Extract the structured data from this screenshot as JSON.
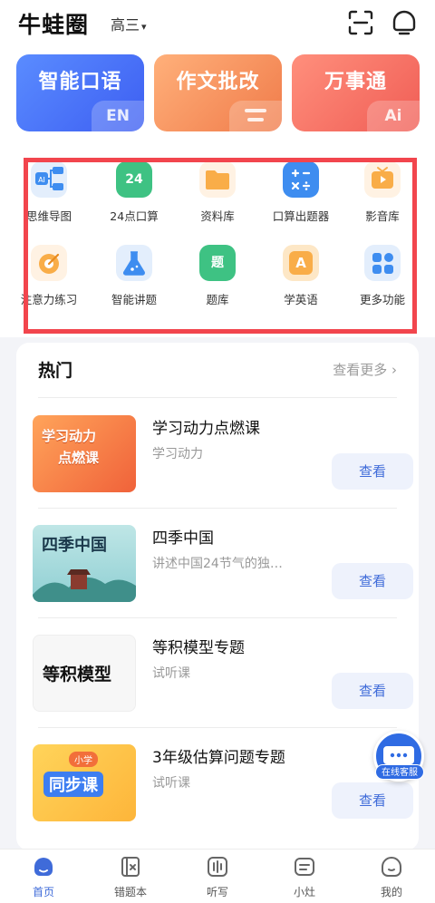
{
  "header": {
    "app_title": "牛蛙圈",
    "grade": "高三",
    "grade_caret": "▾"
  },
  "feature_cards": [
    {
      "label": "智能口语",
      "badge": "EN"
    },
    {
      "label": "作文批改",
      "badge": ""
    },
    {
      "label": "万事通",
      "badge": "Ai"
    }
  ],
  "tools": [
    {
      "label": "思维导图",
      "icon": "mind-map-icon",
      "icon_text": "AI"
    },
    {
      "label": "24点口算",
      "icon": "twenty-four-icon",
      "icon_text": "24"
    },
    {
      "label": "资料库",
      "icon": "folder-icon",
      "icon_text": ""
    },
    {
      "label": "口算出题器",
      "icon": "calculator-icon",
      "icon_text": ""
    },
    {
      "label": "影音库",
      "icon": "media-icon",
      "icon_text": ""
    },
    {
      "label": "注意力练习",
      "icon": "target-icon",
      "icon_text": ""
    },
    {
      "label": "智能讲题",
      "icon": "flask-icon",
      "icon_text": ""
    },
    {
      "label": "题库",
      "icon": "question-bank-icon",
      "icon_text": "题"
    },
    {
      "label": "学英语",
      "icon": "english-icon",
      "icon_text": "A"
    },
    {
      "label": "更多功能",
      "icon": "more-functions-icon",
      "icon_text": ""
    }
  ],
  "hot": {
    "title": "热门",
    "see_more": "查看更多 ›",
    "courses": [
      {
        "title": "学习动力点燃课",
        "subtitle": "学习动力",
        "button": "查看",
        "thumb_text_1": "学习动力",
        "thumb_text_2": "点燃课"
      },
      {
        "title": "四季中国",
        "subtitle": "讲述中国24节气的独…",
        "button": "查看",
        "thumb_text_1": "四季中国"
      },
      {
        "title": "等积模型专题",
        "subtitle": "试听课",
        "button": "查看",
        "thumb_text_1": "等积模型"
      },
      {
        "title": "3年级估算问题专题",
        "subtitle": "试听课",
        "button": "查看",
        "thumb_tag": "小学",
        "thumb_text_1": "同步课"
      }
    ]
  },
  "service": {
    "label": "在线客服"
  },
  "bottom_nav": [
    {
      "label": "首页",
      "icon": "home-icon",
      "active": true
    },
    {
      "label": "错题本",
      "icon": "mistake-book-icon",
      "active": false
    },
    {
      "label": "听写",
      "icon": "dictation-icon",
      "active": false
    },
    {
      "label": "小灶",
      "icon": "tutoring-icon",
      "active": false
    },
    {
      "label": "我的",
      "icon": "profile-icon",
      "active": false
    }
  ],
  "colors": {
    "accent": "#3f6bd9",
    "highlight_border": "#f2454d",
    "oral_card": "#4a74f6",
    "essay_card": "#f5935f",
    "wiki_card": "#f4736a"
  }
}
